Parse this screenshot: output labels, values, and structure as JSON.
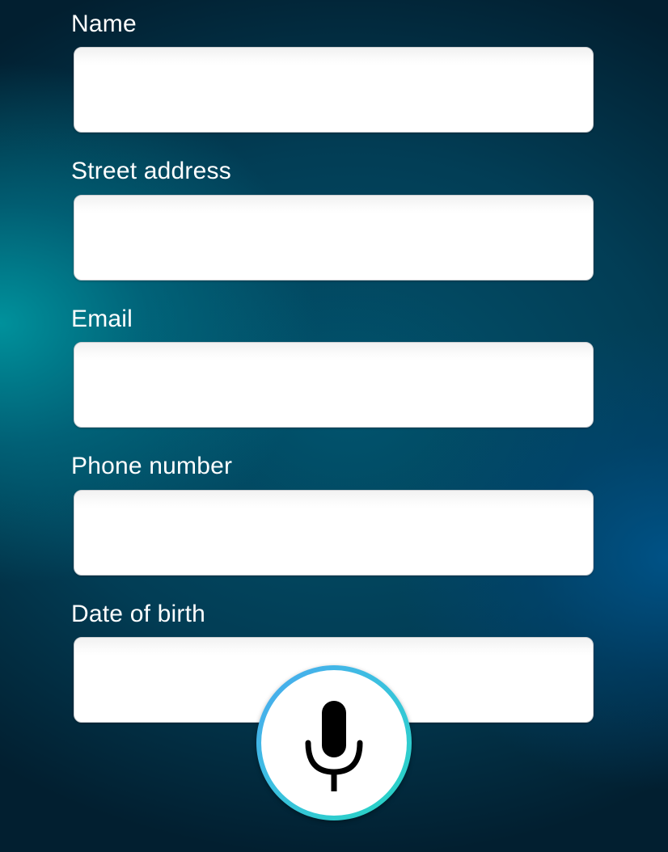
{
  "form": {
    "fields": [
      {
        "label": "Name",
        "value": "",
        "placeholder": ""
      },
      {
        "label": "Street address",
        "value": "",
        "placeholder": ""
      },
      {
        "label": "Email",
        "value": "",
        "placeholder": ""
      },
      {
        "label": "Phone number",
        "value": "",
        "placeholder": ""
      },
      {
        "label": "Date of birth",
        "value": "",
        "placeholder": ""
      }
    ]
  },
  "mic_button": {
    "icon": "microphone-icon",
    "ring_colors": [
      "#4aa8f0",
      "#24d6c0"
    ]
  }
}
